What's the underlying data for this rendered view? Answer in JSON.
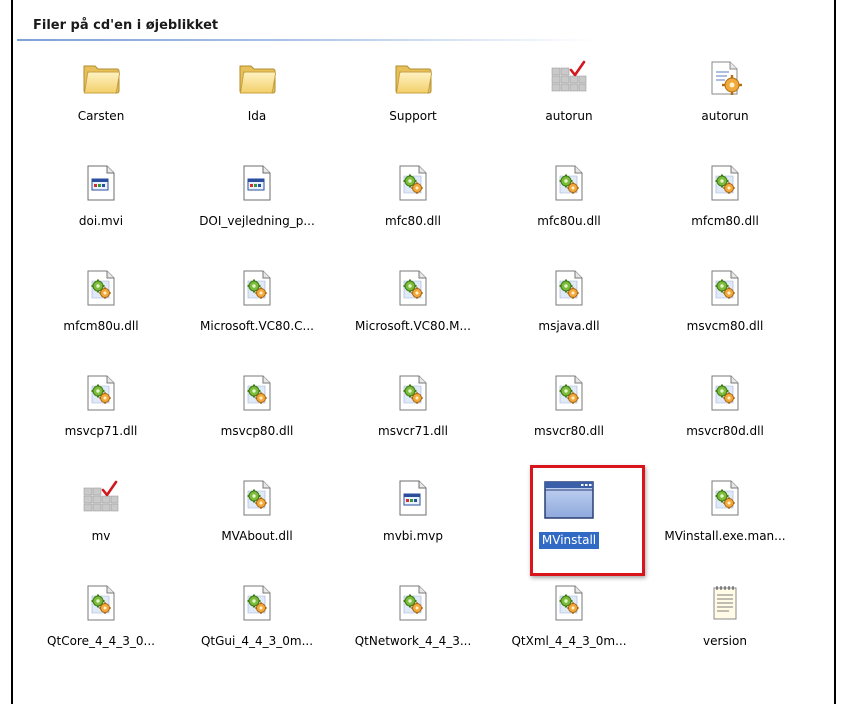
{
  "group": {
    "title": "Filer på cd'en i øjeblikket"
  },
  "items": [
    {
      "label": "Carsten",
      "icon": "folder-icon",
      "kind": "folder"
    },
    {
      "label": "Ida",
      "icon": "folder-icon",
      "kind": "folder"
    },
    {
      "label": "Support",
      "icon": "folder-icon",
      "kind": "folder"
    },
    {
      "label": "autorun",
      "icon": "setup-information-icon",
      "kind": "inf"
    },
    {
      "label": "autorun",
      "icon": "configuration-file-icon",
      "kind": "ini"
    },
    {
      "label": "doi.mvi",
      "icon": "generic-application-file-icon",
      "kind": "appfile"
    },
    {
      "label": "DOI_vejledning_p...",
      "icon": "generic-application-file-icon",
      "kind": "appfile"
    },
    {
      "label": "mfc80.dll",
      "icon": "dll-icon",
      "kind": "dll"
    },
    {
      "label": "mfc80u.dll",
      "icon": "dll-icon",
      "kind": "dll"
    },
    {
      "label": "mfcm80.dll",
      "icon": "dll-icon",
      "kind": "dll"
    },
    {
      "label": "mfcm80u.dll",
      "icon": "dll-icon",
      "kind": "dll"
    },
    {
      "label": "Microsoft.VC80.C...",
      "icon": "dll-icon",
      "kind": "dll"
    },
    {
      "label": "Microsoft.VC80.M...",
      "icon": "dll-icon",
      "kind": "dll"
    },
    {
      "label": "msjava.dll",
      "icon": "dll-icon",
      "kind": "dll"
    },
    {
      "label": "msvcm80.dll",
      "icon": "dll-icon",
      "kind": "dll"
    },
    {
      "label": "msvcp71.dll",
      "icon": "dll-icon",
      "kind": "dll"
    },
    {
      "label": "msvcp80.dll",
      "icon": "dll-icon",
      "kind": "dll"
    },
    {
      "label": "msvcr71.dll",
      "icon": "dll-icon",
      "kind": "dll"
    },
    {
      "label": "msvcr80.dll",
      "icon": "dll-icon",
      "kind": "dll"
    },
    {
      "label": "msvcr80d.dll",
      "icon": "dll-icon",
      "kind": "dll"
    },
    {
      "label": "mv",
      "icon": "setup-information-icon",
      "kind": "inf"
    },
    {
      "label": "MVAbout.dll",
      "icon": "dll-icon",
      "kind": "dll"
    },
    {
      "label": "mvbi.mvp",
      "icon": "generic-application-file-icon",
      "kind": "appfile"
    },
    {
      "label": "MVinstall",
      "icon": "application-window-icon",
      "kind": "exe",
      "selected": true
    },
    {
      "label": "MVinstall.exe.man...",
      "icon": "dll-icon",
      "kind": "dll"
    },
    {
      "label": "QtCore_4_4_3_0...",
      "icon": "dll-icon",
      "kind": "dll"
    },
    {
      "label": "QtGui_4_4_3_0m...",
      "icon": "dll-icon",
      "kind": "dll"
    },
    {
      "label": "QtNetwork_4_4_3...",
      "icon": "dll-icon",
      "kind": "dll"
    },
    {
      "label": "QtXml_4_4_3_0m...",
      "icon": "dll-icon",
      "kind": "dll"
    },
    {
      "label": "version",
      "icon": "text-document-icon",
      "kind": "txt"
    }
  ],
  "colors": {
    "selection": "#316ac5",
    "highlight_box": "#d9141b",
    "group_line": "#7fa0d8"
  }
}
